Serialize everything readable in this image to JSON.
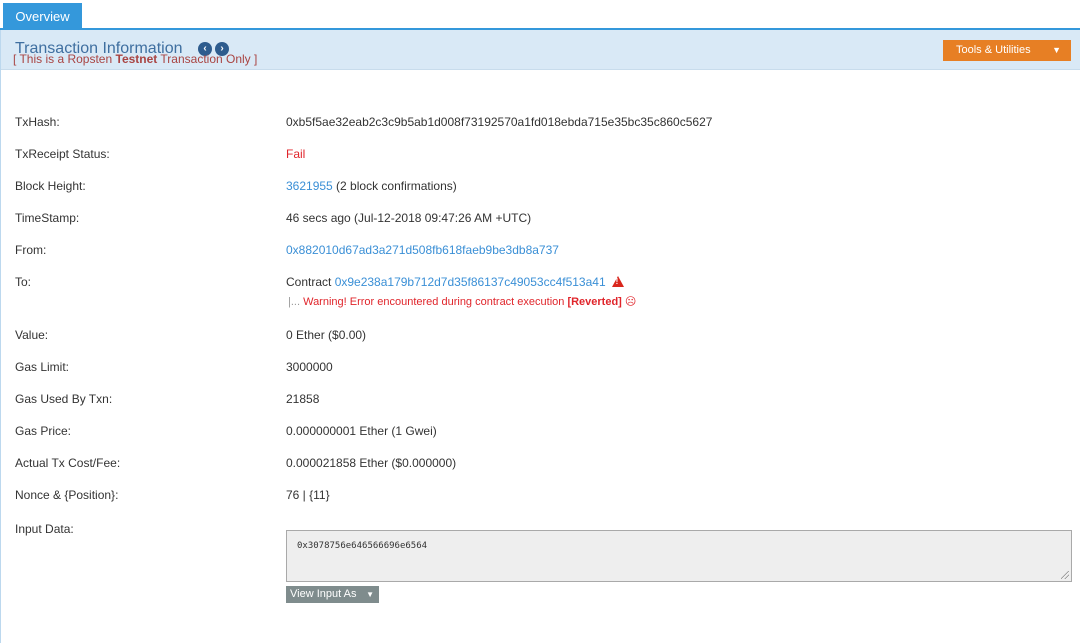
{
  "tabs": {
    "overview_label": "Overview"
  },
  "header": {
    "title": "Transaction Information",
    "prev_icon": "chevron-left-circle-icon",
    "next_icon": "chevron-right-circle-icon",
    "tools_label": "Tools & Utilities"
  },
  "notice": {
    "prefix": "[ This is a Ropsten ",
    "bold": "Testnet",
    "suffix": " Transaction Only ]"
  },
  "rows": {
    "txhash": {
      "label": "TxHash:",
      "value": "0xb5f5ae32eab2c3c9b5ab1d008f73192570a1fd018ebda715e35bc35c860c5627"
    },
    "status": {
      "label": "TxReceipt Status:",
      "value": "Fail"
    },
    "block": {
      "label": "Block Height:",
      "link": "3621955",
      "suffix": " (2 block confirmations)"
    },
    "timestamp": {
      "label": "TimeStamp:",
      "value": "46 secs ago (Jul-12-2018 09:47:26 AM +UTC)"
    },
    "from": {
      "label": "From:",
      "link": "0x882010d67ad3a271d508fb618faeb9be3db8a737"
    },
    "to": {
      "label": "To:",
      "prefix": "Contract ",
      "link": "0x9e238a179b712d7d35f86137c49053cc4f513a41",
      "warning_prefix": "Warning! Error encountered during contract execution ",
      "warning_bold": "[Reverted]"
    },
    "value": {
      "label": "Value:",
      "value": "0 Ether ($0.00)"
    },
    "gas_limit": {
      "label": "Gas Limit:",
      "value": "3000000"
    },
    "gas_used": {
      "label": "Gas Used By Txn:",
      "value": "21858"
    },
    "gas_price": {
      "label": "Gas Price:",
      "value": "0.000000001 Ether (1 Gwei)"
    },
    "tx_cost": {
      "label": "Actual Tx Cost/Fee:",
      "value": "0.000021858 Ether ($0.000000)"
    },
    "nonce": {
      "label": "Nonce & {Position}:",
      "value": "76 | {11}"
    },
    "input": {
      "label": "Input Data:",
      "value": "0x3078756e646566696e6564",
      "view_label": "View Input As"
    }
  },
  "colors": {
    "accent_blue": "#3498db",
    "header_bg": "#d9e9f6",
    "title_blue": "#3f6fa0",
    "tools_orange": "#e77f24",
    "link_blue": "#3a8fd6",
    "error_red": "#e0252b",
    "notice_red": "#a94442"
  }
}
